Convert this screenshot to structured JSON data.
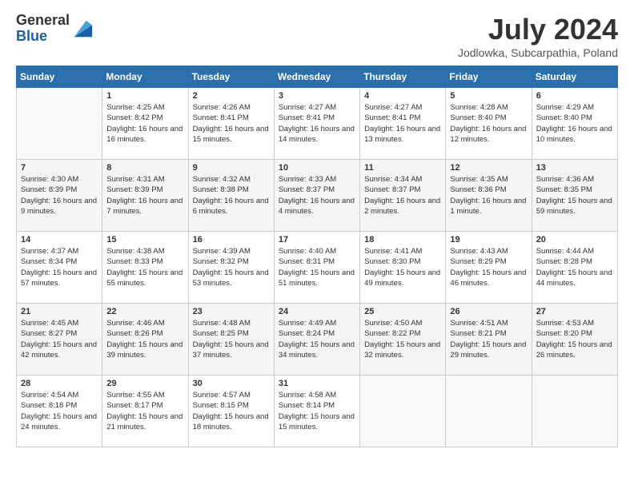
{
  "header": {
    "logo_general": "General",
    "logo_blue": "Blue",
    "month_title": "July 2024",
    "location": "Jodlowka, Subcarpathia, Poland"
  },
  "columns": [
    "Sunday",
    "Monday",
    "Tuesday",
    "Wednesday",
    "Thursday",
    "Friday",
    "Saturday"
  ],
  "weeks": [
    [
      {
        "day": "",
        "empty": true
      },
      {
        "day": "1",
        "sunrise": "Sunrise: 4:25 AM",
        "sunset": "Sunset: 8:42 PM",
        "daylight": "Daylight: 16 hours and 16 minutes."
      },
      {
        "day": "2",
        "sunrise": "Sunrise: 4:26 AM",
        "sunset": "Sunset: 8:41 PM",
        "daylight": "Daylight: 16 hours and 15 minutes."
      },
      {
        "day": "3",
        "sunrise": "Sunrise: 4:27 AM",
        "sunset": "Sunset: 8:41 PM",
        "daylight": "Daylight: 16 hours and 14 minutes."
      },
      {
        "day": "4",
        "sunrise": "Sunrise: 4:27 AM",
        "sunset": "Sunset: 8:41 PM",
        "daylight": "Daylight: 16 hours and 13 minutes."
      },
      {
        "day": "5",
        "sunrise": "Sunrise: 4:28 AM",
        "sunset": "Sunset: 8:40 PM",
        "daylight": "Daylight: 16 hours and 12 minutes."
      },
      {
        "day": "6",
        "sunrise": "Sunrise: 4:29 AM",
        "sunset": "Sunset: 8:40 PM",
        "daylight": "Daylight: 16 hours and 10 minutes."
      }
    ],
    [
      {
        "day": "7",
        "sunrise": "Sunrise: 4:30 AM",
        "sunset": "Sunset: 8:39 PM",
        "daylight": "Daylight: 16 hours and 9 minutes."
      },
      {
        "day": "8",
        "sunrise": "Sunrise: 4:31 AM",
        "sunset": "Sunset: 8:39 PM",
        "daylight": "Daylight: 16 hours and 7 minutes."
      },
      {
        "day": "9",
        "sunrise": "Sunrise: 4:32 AM",
        "sunset": "Sunset: 8:38 PM",
        "daylight": "Daylight: 16 hours and 6 minutes."
      },
      {
        "day": "10",
        "sunrise": "Sunrise: 4:33 AM",
        "sunset": "Sunset: 8:37 PM",
        "daylight": "Daylight: 16 hours and 4 minutes."
      },
      {
        "day": "11",
        "sunrise": "Sunrise: 4:34 AM",
        "sunset": "Sunset: 8:37 PM",
        "daylight": "Daylight: 16 hours and 2 minutes."
      },
      {
        "day": "12",
        "sunrise": "Sunrise: 4:35 AM",
        "sunset": "Sunset: 8:36 PM",
        "daylight": "Daylight: 16 hours and 1 minute."
      },
      {
        "day": "13",
        "sunrise": "Sunrise: 4:36 AM",
        "sunset": "Sunset: 8:35 PM",
        "daylight": "Daylight: 15 hours and 59 minutes."
      }
    ],
    [
      {
        "day": "14",
        "sunrise": "Sunrise: 4:37 AM",
        "sunset": "Sunset: 8:34 PM",
        "daylight": "Daylight: 15 hours and 57 minutes."
      },
      {
        "day": "15",
        "sunrise": "Sunrise: 4:38 AM",
        "sunset": "Sunset: 8:33 PM",
        "daylight": "Daylight: 15 hours and 55 minutes."
      },
      {
        "day": "16",
        "sunrise": "Sunrise: 4:39 AM",
        "sunset": "Sunset: 8:32 PM",
        "daylight": "Daylight: 15 hours and 53 minutes."
      },
      {
        "day": "17",
        "sunrise": "Sunrise: 4:40 AM",
        "sunset": "Sunset: 8:31 PM",
        "daylight": "Daylight: 15 hours and 51 minutes."
      },
      {
        "day": "18",
        "sunrise": "Sunrise: 4:41 AM",
        "sunset": "Sunset: 8:30 PM",
        "daylight": "Daylight: 15 hours and 49 minutes."
      },
      {
        "day": "19",
        "sunrise": "Sunrise: 4:43 AM",
        "sunset": "Sunset: 8:29 PM",
        "daylight": "Daylight: 15 hours and 46 minutes."
      },
      {
        "day": "20",
        "sunrise": "Sunrise: 4:44 AM",
        "sunset": "Sunset: 8:28 PM",
        "daylight": "Daylight: 15 hours and 44 minutes."
      }
    ],
    [
      {
        "day": "21",
        "sunrise": "Sunrise: 4:45 AM",
        "sunset": "Sunset: 8:27 PM",
        "daylight": "Daylight: 15 hours and 42 minutes."
      },
      {
        "day": "22",
        "sunrise": "Sunrise: 4:46 AM",
        "sunset": "Sunset: 8:26 PM",
        "daylight": "Daylight: 15 hours and 39 minutes."
      },
      {
        "day": "23",
        "sunrise": "Sunrise: 4:48 AM",
        "sunset": "Sunset: 8:25 PM",
        "daylight": "Daylight: 15 hours and 37 minutes."
      },
      {
        "day": "24",
        "sunrise": "Sunrise: 4:49 AM",
        "sunset": "Sunset: 8:24 PM",
        "daylight": "Daylight: 15 hours and 34 minutes."
      },
      {
        "day": "25",
        "sunrise": "Sunrise: 4:50 AM",
        "sunset": "Sunset: 8:22 PM",
        "daylight": "Daylight: 15 hours and 32 minutes."
      },
      {
        "day": "26",
        "sunrise": "Sunrise: 4:51 AM",
        "sunset": "Sunset: 8:21 PM",
        "daylight": "Daylight: 15 hours and 29 minutes."
      },
      {
        "day": "27",
        "sunrise": "Sunrise: 4:53 AM",
        "sunset": "Sunset: 8:20 PM",
        "daylight": "Daylight: 15 hours and 26 minutes."
      }
    ],
    [
      {
        "day": "28",
        "sunrise": "Sunrise: 4:54 AM",
        "sunset": "Sunset: 8:18 PM",
        "daylight": "Daylight: 15 hours and 24 minutes."
      },
      {
        "day": "29",
        "sunrise": "Sunrise: 4:55 AM",
        "sunset": "Sunset: 8:17 PM",
        "daylight": "Daylight: 15 hours and 21 minutes."
      },
      {
        "day": "30",
        "sunrise": "Sunrise: 4:57 AM",
        "sunset": "Sunset: 8:15 PM",
        "daylight": "Daylight: 15 hours and 18 minutes."
      },
      {
        "day": "31",
        "sunrise": "Sunrise: 4:58 AM",
        "sunset": "Sunset: 8:14 PM",
        "daylight": "Daylight: 15 hours and 15 minutes."
      },
      {
        "day": "",
        "empty": true
      },
      {
        "day": "",
        "empty": true
      },
      {
        "day": "",
        "empty": true
      }
    ]
  ]
}
